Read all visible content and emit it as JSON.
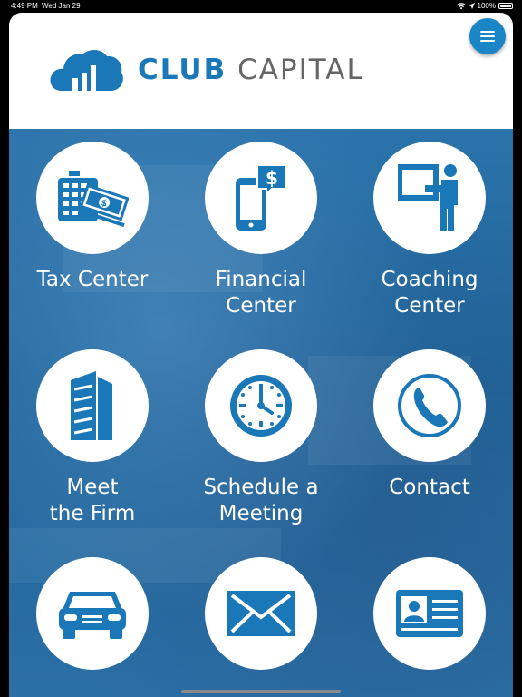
{
  "status_bar": {
    "time": "4:49 PM",
    "date": "Wed Jan 29",
    "battery": "100%"
  },
  "header": {
    "logo_word1": "CLUB",
    "logo_word2": "CAPITAL",
    "menu_icon": "hamburger-icon"
  },
  "colors": {
    "brand_blue": "#1a78b8",
    "logo_gray": "#666666",
    "background_blue": "#1f6aa0"
  },
  "tiles": [
    {
      "label": "Tax Center",
      "icon": "calculator-money-icon"
    },
    {
      "label": "Financial\nCenter",
      "icon": "phone-dollar-icon"
    },
    {
      "label": "Coaching\nCenter",
      "icon": "presenter-board-icon"
    },
    {
      "label": "Meet\nthe Firm",
      "icon": "building-icon"
    },
    {
      "label": "Schedule a\nMeeting",
      "icon": "clock-icon"
    },
    {
      "label": "Contact",
      "icon": "phone-handset-icon"
    },
    {
      "label": "",
      "icon": "car-icon"
    },
    {
      "label": "",
      "icon": "envelope-icon"
    },
    {
      "label": "",
      "icon": "id-card-icon"
    }
  ]
}
